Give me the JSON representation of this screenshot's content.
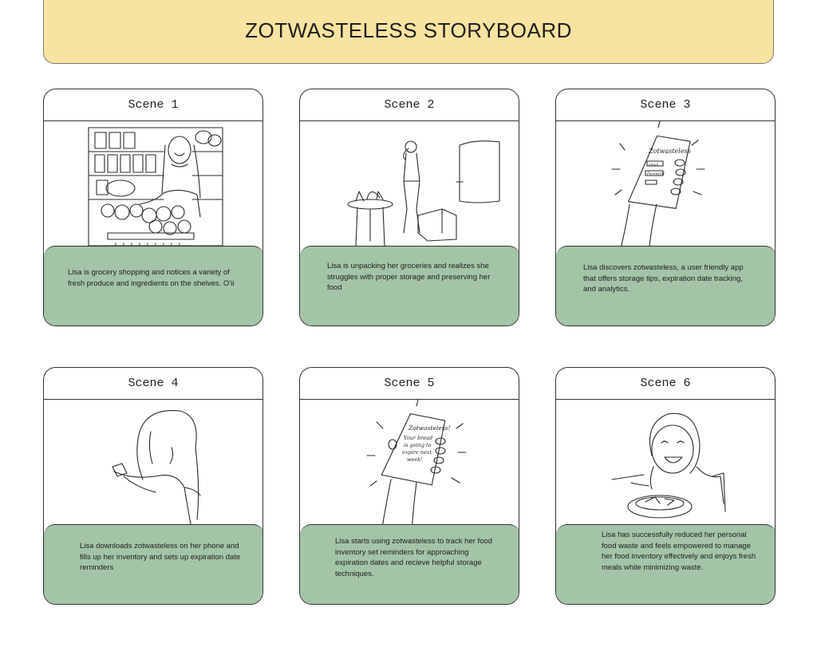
{
  "title": "ZOTWASTELESS STORYBOARD",
  "scenes": [
    {
      "label": "Scene 1",
      "caption": "Lisa is grocery shopping and notices a variety of fresh produce and ingredients on the shelves. O'ii"
    },
    {
      "label": "Scene 2",
      "caption": "Lisa is unpacking her groceries and  realizes she struggles with proper storage and preserving her food"
    },
    {
      "label": "Scene 3",
      "caption": "Lisa discovers zotwasteless, a user friendly app that offers storage tips, expiration date tracking, and analytics.",
      "phone_text": {
        "app": "Zotwasteless",
        "email": "email",
        "password": "Password"
      }
    },
    {
      "label": "Scene 4",
      "caption": "Lisa downloads zotwasteless on her phone and fills up her inventory and sets up expiration date reminders"
    },
    {
      "label": "Scene 5",
      "caption": "Lisa starts using zotwasteless to track her food inventory set reminders for approaching expiration dates and recieve helpful storage techniques.",
      "phone_text": {
        "app": "Zotwasteless!",
        "line1": "Your bread",
        "line2": "is going to",
        "line3": "expire next",
        "line4": "week!"
      }
    },
    {
      "label": "Scene 6",
      "caption": "Lisa has successfully reduced her personal food waste and feels empowered to manage her food inventory effectively and enjoys fresh meals while minimizing waste."
    }
  ]
}
